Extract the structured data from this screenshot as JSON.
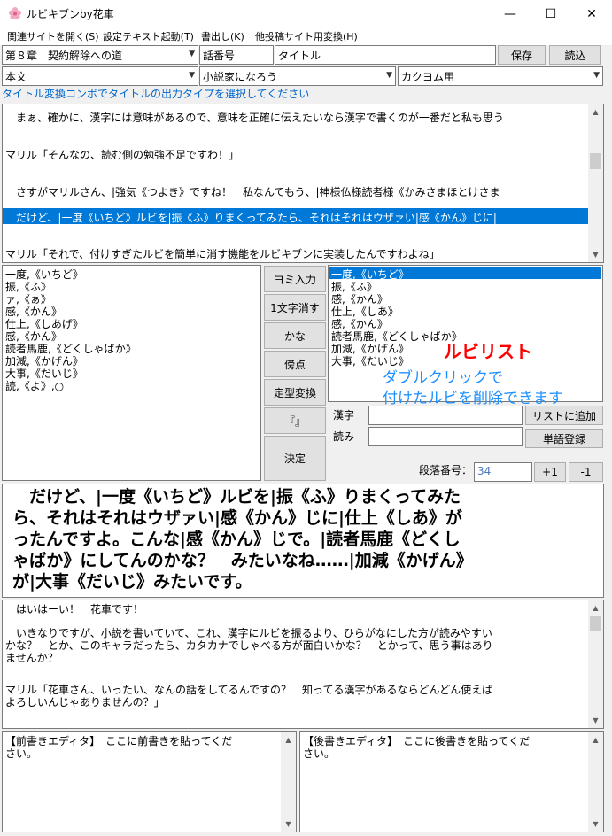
{
  "window": {
    "title": "ルビキブンby花車",
    "minimize": "—",
    "maximize": "☐",
    "close": "✕"
  },
  "menu": [
    "関連サイトを開く(S)",
    "設定テキスト起動(T)",
    "書出し(K)",
    "他投稿サイト用変換(H)"
  ],
  "header": {
    "chapter_value": "第８章　契約解除への道",
    "episode_label": "話番号",
    "title_value": "タイトル",
    "save_label": "保存",
    "load_label": "読込",
    "text_type": "本文",
    "site": "小説家になろう",
    "target": "カクヨム用",
    "hint": "タイトル変換コンボでタイトルの出力タイプを選択してください"
  },
  "editor": {
    "lines": [
      "　まぁ、確かに、漢字には意味があるので、意味を正確に伝えたいなら漢字で書くのが一番だと私も思う",
      "マリル「そんなの、読む側の勉強不足ですわ！」",
      "　さすがマリルさん、|強気《つよき》ですね！　私なんてもう、|神様仏様読者様《かみさまほとけさま",
      "　だけど、|一度《いちど》ルビを|振《ふ》りまくってみたら、それはそれはウザァい|感《かん》じに|",
      "マリル「それで、付けすぎたルビを簡単に消す機能をルビキブンに実装したんですわよね」"
    ]
  },
  "left_list": [
    "一度,《いちど》",
    "振,《ふ》",
    "ァ,《ぁ》",
    "感,《かん》",
    "仕上,《しあげ》",
    "感,《かん》",
    "読者馬鹿,《どくしゃばか》",
    "加減,《かげん》",
    "大事,《だいじ》",
    "読,《よ》,○"
  ],
  "buttons": {
    "yomi": "ヨミ入力",
    "delete_one": "1文字消す",
    "kana": "かな",
    "boten": "傍点",
    "teikei": "定型変換",
    "kakko": "『』",
    "kettei": "決定"
  },
  "ruby_list": {
    "items": [
      "一度,《いちど》",
      "振,《ふ》",
      "感,《かん》",
      "仕上,《しあ》",
      "感,《かん》",
      "読者馬鹿,《どくしゃばか》",
      "加減,《かげん》",
      "大事,《だいじ》"
    ],
    "annotation_title": "ルビリスト",
    "annotation_line1": "ダブルクリックで",
    "annotation_line2": "付けたルビを削除できます"
  },
  "word_form": {
    "kanji_label": "漢字",
    "yomi_label": "読み",
    "add_label": "リストに追加",
    "register_label": "単語登録",
    "para_label": "段落番号：",
    "para_value": "34",
    "plus": "+1",
    "minus": "-1"
  },
  "preview": {
    "lines": [
      "　だけど、|一度《いちど》ルビを|振《ふ》りまくってみた",
      "ら、それはそれはウザァい|感《かん》じに|仕上《しあ》が",
      "ったんですよ。こんな|感《かん》じで。|読者馬鹿《どくし",
      "ゃばか》にしてんのかな？　みたいなね……|加減《かげん》",
      "が|大事《だいじ》みたいです。"
    ]
  },
  "lower_editor": {
    "lines": [
      "　はいはーい！　花車です！",
      "　いきなりですが、小説を書いていて、これ、漢字にルビを振るより、ひらがなにした方が読みやすい",
      "かな？　とか、このキャラだったら、カタカナでしゃべる方が面白いかな？　とかって、思う事はあり",
      "ませんか？",
      "マリル「花車さん、いったい、なんの話をしてるんですの？　知ってる漢字があるならどんどん使えば",
      "よろしいんじゃありませんの？」"
    ]
  },
  "maegaki": {
    "line1": "【前書きエディタ】　ここに前書きを貼ってくだ",
    "line2": "さい。"
  },
  "atogaki": {
    "line1": "【後書きエディタ】　ここに後書きを貼ってくだ",
    "line2": "さい。"
  },
  "colors": {
    "selection": "#0078d7",
    "annotation_red": "#ff0000",
    "annotation_blue": "#1e90ff",
    "hint_blue": "#0066cc"
  }
}
